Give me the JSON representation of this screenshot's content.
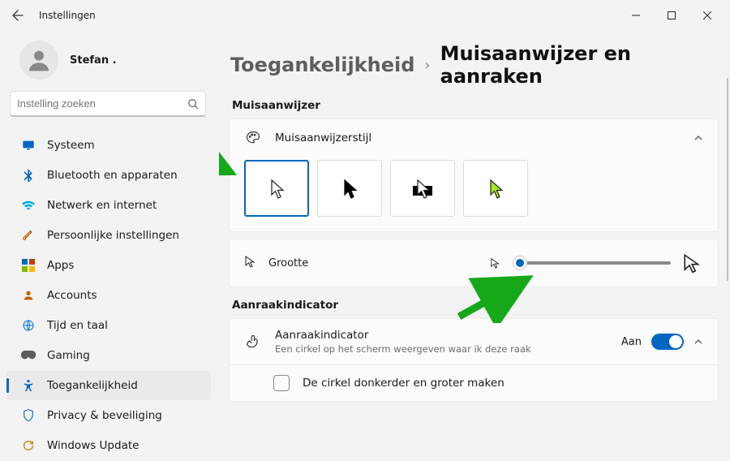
{
  "window": {
    "title": "Instellingen"
  },
  "profile": {
    "name": "Stefan ."
  },
  "search": {
    "placeholder": "Instelling zoeken",
    "value": ""
  },
  "nav": {
    "items": [
      {
        "label": "Systeem",
        "icon": "monitor"
      },
      {
        "label": "Bluetooth en apparaten",
        "icon": "bluetooth"
      },
      {
        "label": "Netwerk en internet",
        "icon": "wifi"
      },
      {
        "label": "Persoonlijke instellingen",
        "icon": "brush"
      },
      {
        "label": "Apps",
        "icon": "apps"
      },
      {
        "label": "Accounts",
        "icon": "person"
      },
      {
        "label": "Tijd en taal",
        "icon": "globe"
      },
      {
        "label": "Gaming",
        "icon": "game"
      },
      {
        "label": "Toegankelijkheid",
        "icon": "accessibility"
      },
      {
        "label": "Privacy & beveiliging",
        "icon": "shield"
      },
      {
        "label": "Windows Update",
        "icon": "update"
      }
    ],
    "selected_index": 8
  },
  "breadcrumb": {
    "parent": "Toegankelijkheid",
    "sep": "›",
    "current": "Muisaanwijzer en aanraken"
  },
  "section_pointer": {
    "heading": "Muisaanwijzer",
    "style_row": {
      "title": "Muisaanwijzerstijl"
    },
    "styles": [
      {
        "kind": "white",
        "selected": true
      },
      {
        "kind": "black",
        "selected": false
      },
      {
        "kind": "inverted",
        "selected": false
      },
      {
        "kind": "custom-color",
        "selected": false,
        "color": "#A8E61D"
      }
    ],
    "size_row": {
      "title": "Grootte"
    },
    "size_value_pct": 5
  },
  "section_touch": {
    "heading": "Aanraakindicator",
    "row": {
      "title": "Aanraakindicator",
      "subtitle": "Een cirkel op het scherm weergeven waar ik deze raak",
      "state_label": "Aan",
      "on": true
    },
    "sub_row": {
      "title": "De cirkel donkerder en groter maken",
      "checked": false
    }
  }
}
